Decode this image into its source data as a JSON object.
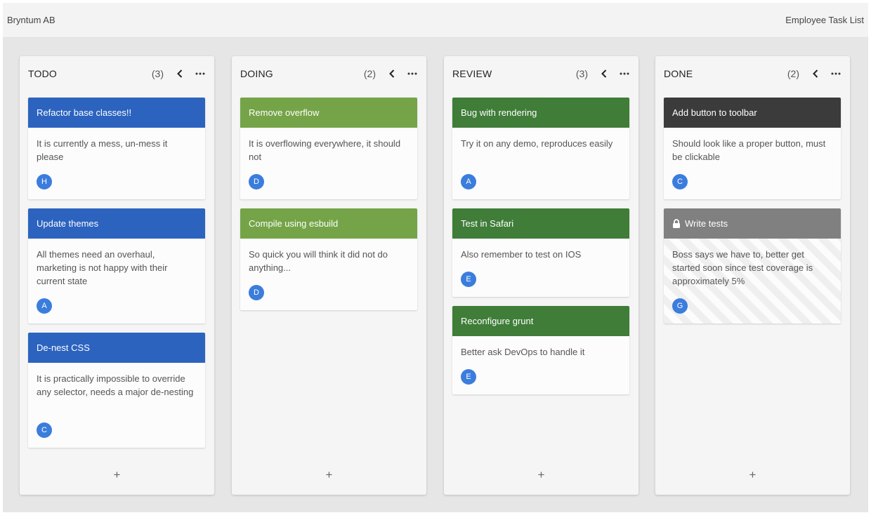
{
  "topbar": {
    "company": "Bryntum AB",
    "title": "Employee Task List"
  },
  "colors": {
    "blue": "#2c63bf",
    "lightgreen": "#74a447",
    "darkgreen": "#3f7d38",
    "dark": "#3b3b3b",
    "gray": "#808080",
    "avatar": "#3b7ddd"
  },
  "columns": [
    {
      "title": "TODO",
      "count": "(3)",
      "add": "+",
      "cards": [
        {
          "title": "Refactor base classes!!",
          "body": "It is currently a mess, un-mess it please",
          "avatar": "H"
        },
        {
          "title": "Update themes",
          "body": "All themes need an overhaul, marketing is not happy with their current state",
          "avatar": "A"
        },
        {
          "title": "De-nest CSS",
          "body": "It is practically impossible to override any selector, needs a major de-nesting",
          "avatar": "C"
        }
      ]
    },
    {
      "title": "DOING",
      "count": "(2)",
      "add": "+",
      "cards": [
        {
          "title": "Remove overflow",
          "body": "It is overflowing everywhere, it should not",
          "avatar": "D"
        },
        {
          "title": "Compile using esbuild",
          "body": "So quick you will think it did not do anything...",
          "avatar": "D"
        }
      ]
    },
    {
      "title": "REVIEW",
      "count": "(3)",
      "add": "+",
      "cards": [
        {
          "title": "Bug with rendering",
          "body": "Try it on any demo, reproduces easily",
          "avatar": "A"
        },
        {
          "title": "Test in Safari",
          "body": "Also remember to test on IOS",
          "avatar": "E"
        },
        {
          "title": "Reconfigure grunt",
          "body": "Better ask DevOps to handle it",
          "avatar": "E"
        }
      ]
    },
    {
      "title": "DONE",
      "count": "(2)",
      "add": "+",
      "cards": [
        {
          "title": "Add button to toolbar",
          "body": "Should look like a proper button, must be clickable",
          "avatar": "C"
        },
        {
          "title": "Write tests",
          "body": "Boss says we have to, better get started soon since test coverage is approximately 5%",
          "avatar": "G",
          "locked": true
        }
      ]
    }
  ]
}
